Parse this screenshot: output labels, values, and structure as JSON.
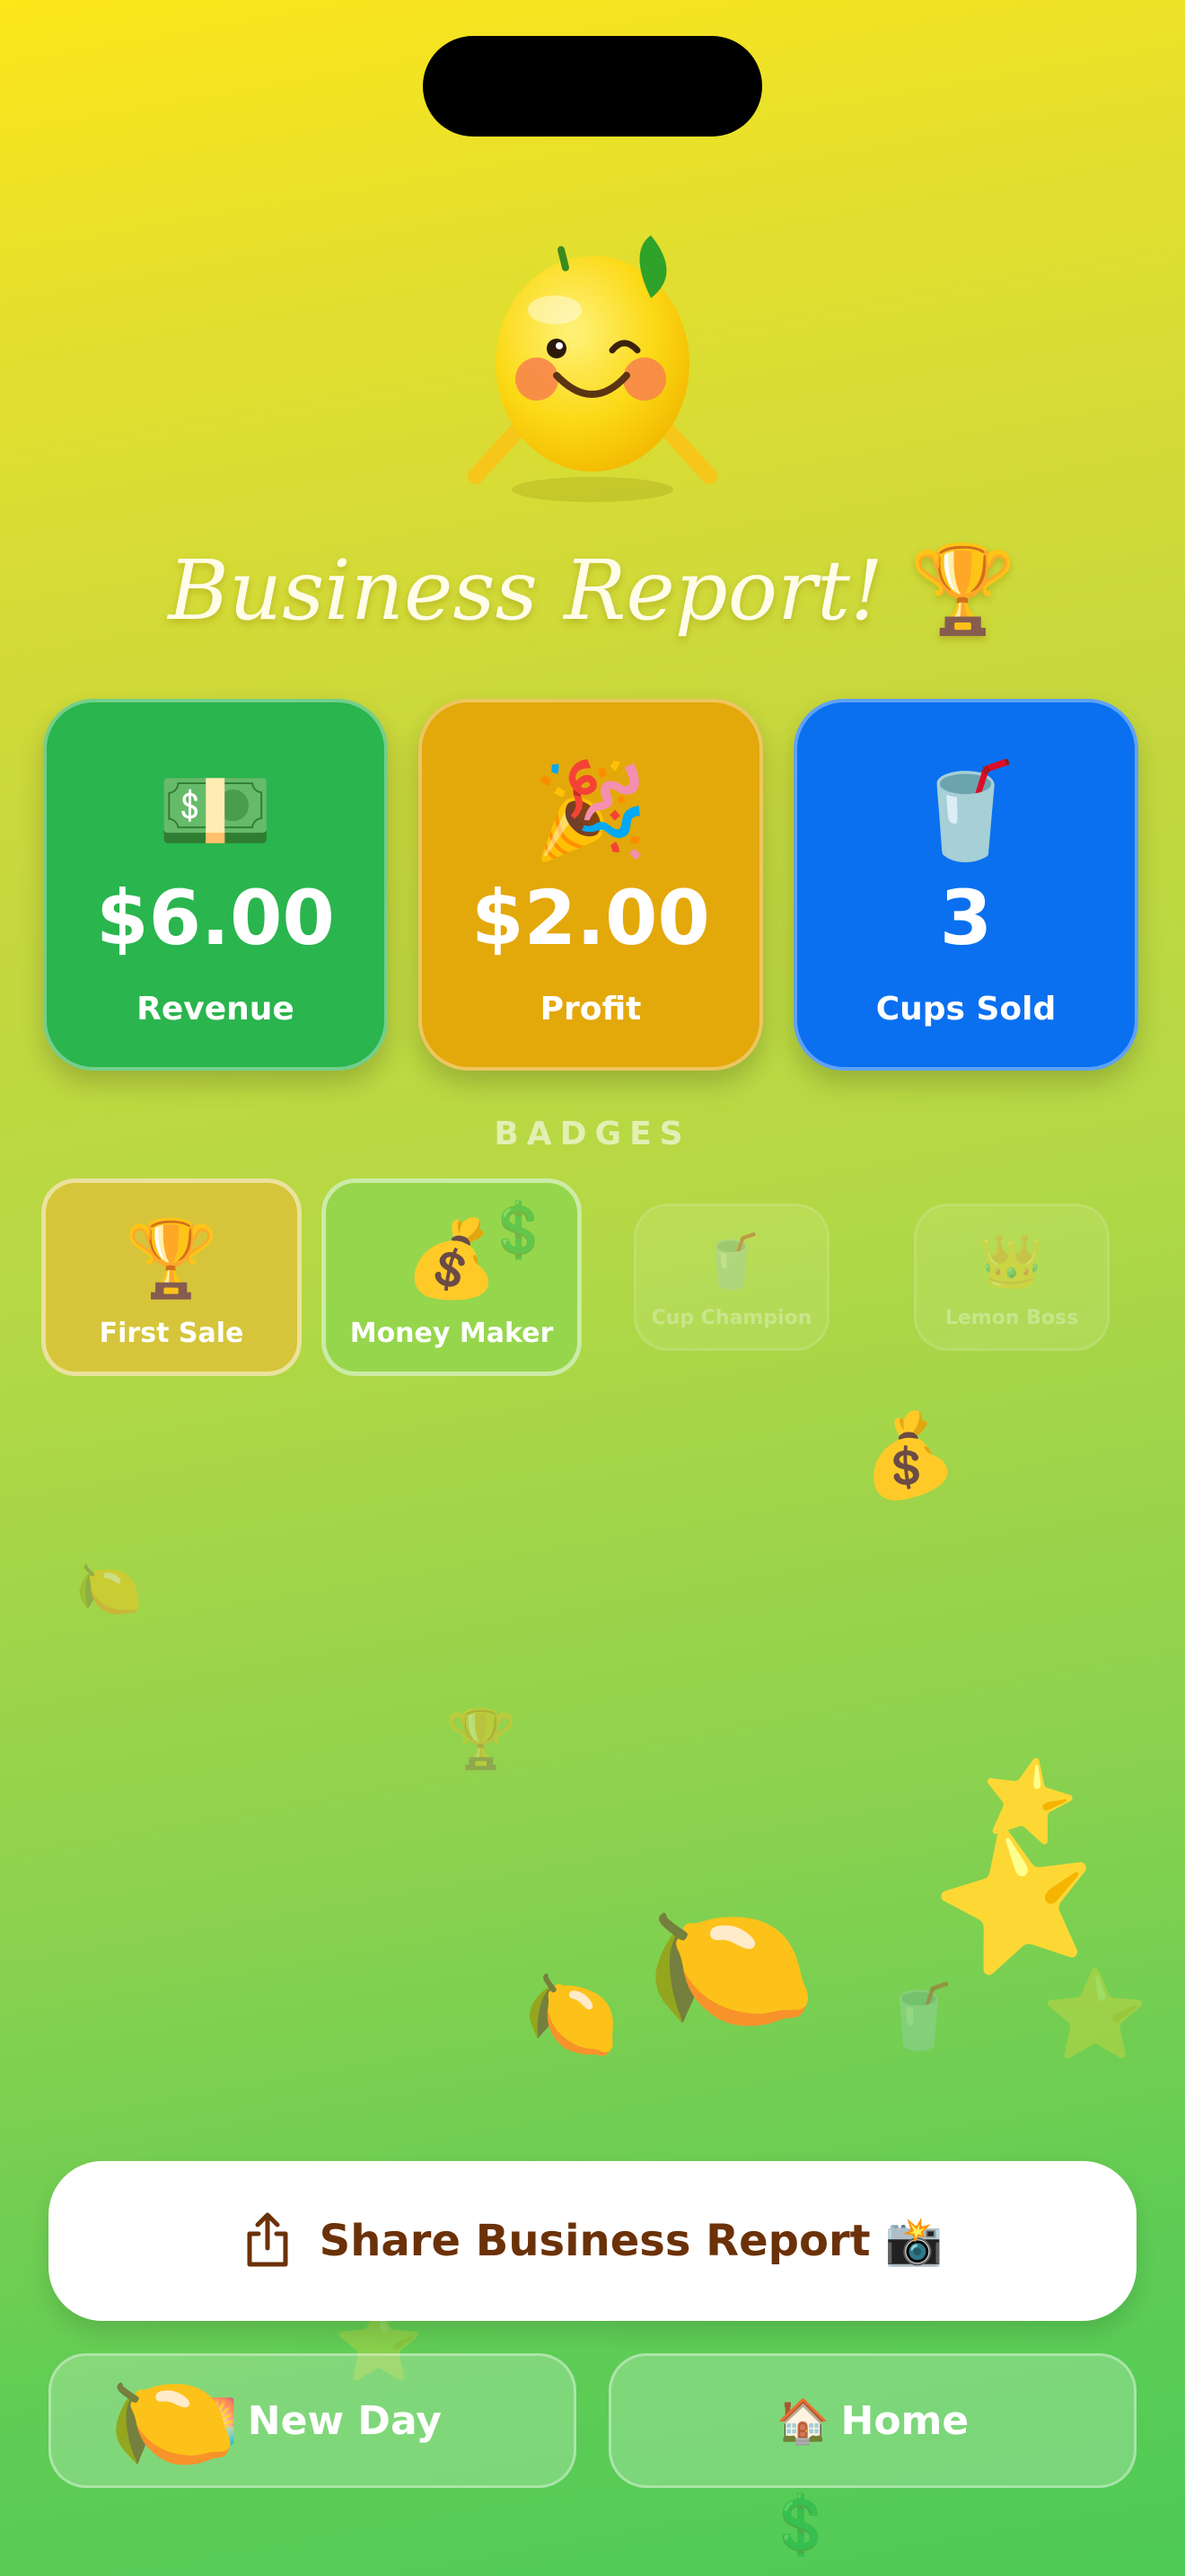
{
  "header": {
    "title": "Business Report!",
    "title_icon": "🏆"
  },
  "stats": [
    {
      "icon": "💵",
      "value": "$6.00",
      "label": "Revenue",
      "color": "#2ab54e"
    },
    {
      "icon": "🎉",
      "value": "$2.00",
      "label": "Profit",
      "color": "#e3a80a"
    },
    {
      "icon": "🥤",
      "value": "3",
      "label": "Cups Sold",
      "color": "#0a70f0"
    }
  ],
  "badges": {
    "title": "BADGES",
    "items": [
      {
        "icon": "🏆",
        "label": "First Sale",
        "earned": true
      },
      {
        "icon": "💰",
        "label": "Money Maker",
        "earned": true
      },
      {
        "icon": "🥤",
        "label": "Cup Champion",
        "earned": false
      },
      {
        "icon": "👑",
        "label": "Lemon Boss",
        "earned": false
      }
    ]
  },
  "actions": {
    "share_label": "Share Business Report",
    "share_emoji": "📸",
    "new_day_icon": "🌅",
    "new_day_label": "New Day",
    "home_icon": "🏠",
    "home_label": "Home"
  },
  "decorations": {
    "money_bag": "💰",
    "lemon": "🍋",
    "trophy": "🏆",
    "star": "⭐",
    "cup": "🥤",
    "dollar": "💲"
  }
}
